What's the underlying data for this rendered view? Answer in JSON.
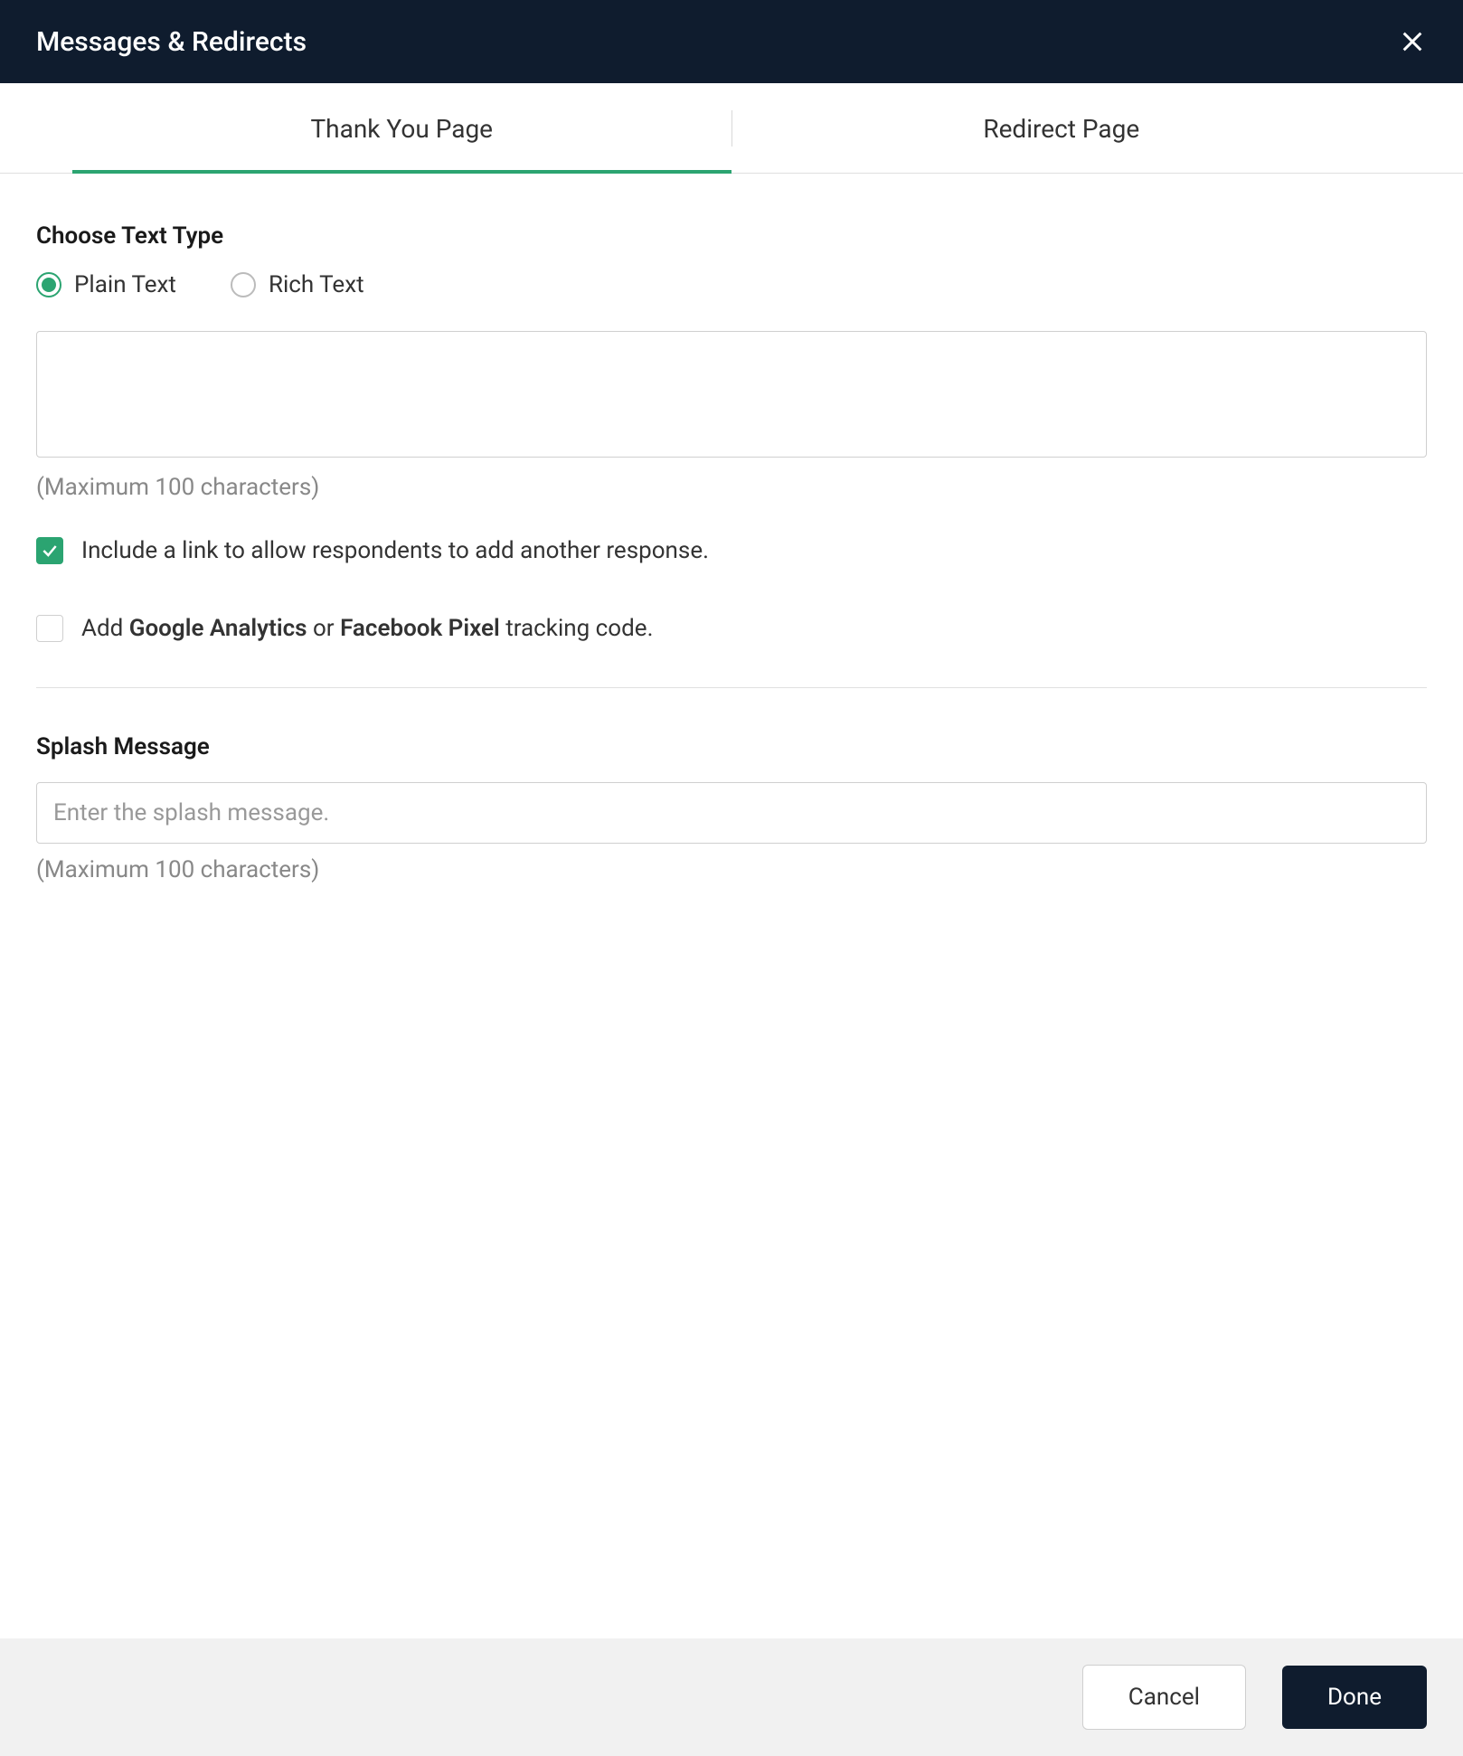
{
  "header": {
    "title": "Messages & Redirects"
  },
  "tabs": {
    "thank_you": "Thank You Page",
    "redirect": "Redirect Page"
  },
  "text_type": {
    "label": "Choose Text Type",
    "plain": "Plain Text",
    "rich": "Rich Text"
  },
  "message_area": {
    "value": "",
    "helper": "(Maximum 100 characters)"
  },
  "checkbox1": {
    "label": "Include a link to allow respondents to add another response."
  },
  "checkbox2": {
    "prefix": "Add ",
    "bold1": "Google Analytics",
    "mid": " or ",
    "bold2": "Facebook Pixel",
    "suffix": " tracking code."
  },
  "splash": {
    "label": "Splash Message",
    "placeholder": "Enter the splash message.",
    "value": "",
    "helper": "(Maximum 100 characters)"
  },
  "footer": {
    "cancel": "Cancel",
    "done": "Done"
  }
}
